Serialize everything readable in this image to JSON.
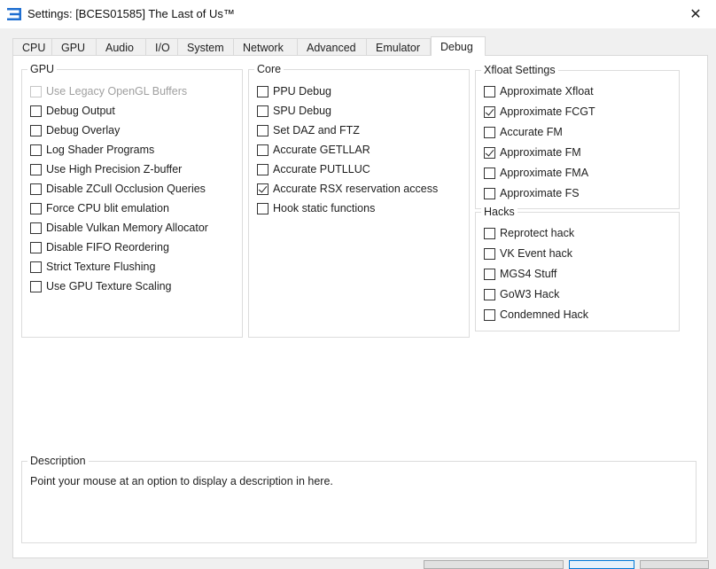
{
  "window": {
    "title": "Settings: [BCES01585] The Last of Us™",
    "close_glyph": "✕",
    "icon": "rpcs3-logo-icon"
  },
  "tabs": [
    {
      "label": "CPU"
    },
    {
      "label": "GPU"
    },
    {
      "label": "Audio"
    },
    {
      "label": "I/O"
    },
    {
      "label": "System"
    },
    {
      "label": "Network"
    },
    {
      "label": "Advanced"
    },
    {
      "label": "Emulator"
    },
    {
      "label": "Debug"
    }
  ],
  "active_tab": "Debug",
  "groups": {
    "gpu": {
      "title": "GPU",
      "items": [
        {
          "label": "Use Legacy OpenGL Buffers",
          "checked": false,
          "disabled": true
        },
        {
          "label": "Debug Output",
          "checked": false
        },
        {
          "label": "Debug Overlay",
          "checked": false
        },
        {
          "label": "Log Shader Programs",
          "checked": false
        },
        {
          "label": "Use High Precision Z-buffer",
          "checked": false
        },
        {
          "label": "Disable ZCull Occlusion Queries",
          "checked": false
        },
        {
          "label": "Force CPU blit emulation",
          "checked": false
        },
        {
          "label": "Disable Vulkan Memory Allocator",
          "checked": false
        },
        {
          "label": "Disable FIFO Reordering",
          "checked": false
        },
        {
          "label": "Strict Texture Flushing",
          "checked": false
        },
        {
          "label": "Use GPU Texture Scaling",
          "checked": false
        }
      ]
    },
    "core": {
      "title": "Core",
      "items": [
        {
          "label": "PPU Debug",
          "checked": false
        },
        {
          "label": "SPU Debug",
          "checked": false
        },
        {
          "label": "Set DAZ and FTZ",
          "checked": false
        },
        {
          "label": "Accurate GETLLAR",
          "checked": false
        },
        {
          "label": "Accurate PUTLLUC",
          "checked": false
        },
        {
          "label": "Accurate RSX reservation access",
          "checked": true
        },
        {
          "label": "Hook static functions",
          "checked": false
        }
      ]
    },
    "xfloat": {
      "title": "Xfloat Settings",
      "items": [
        {
          "label": "Approximate Xfloat",
          "checked": false
        },
        {
          "label": "Approximate FCGT",
          "checked": true
        },
        {
          "label": "Accurate FM",
          "checked": false
        },
        {
          "label": "Approximate FM",
          "checked": true
        },
        {
          "label": "Approximate FMA",
          "checked": false
        },
        {
          "label": "Approximate FS",
          "checked": false
        }
      ]
    },
    "hacks": {
      "title": "Hacks",
      "items": [
        {
          "label": "Reprotect hack",
          "checked": false
        },
        {
          "label": "VK Event hack",
          "checked": false
        },
        {
          "label": "MGS4 Stuff",
          "checked": false
        },
        {
          "label": "GoW3 Hack",
          "checked": false
        },
        {
          "label": "Condemned Hack",
          "checked": false
        }
      ]
    }
  },
  "description": {
    "title": "Description",
    "text": "Point your mouse at an option to display a description in here."
  }
}
